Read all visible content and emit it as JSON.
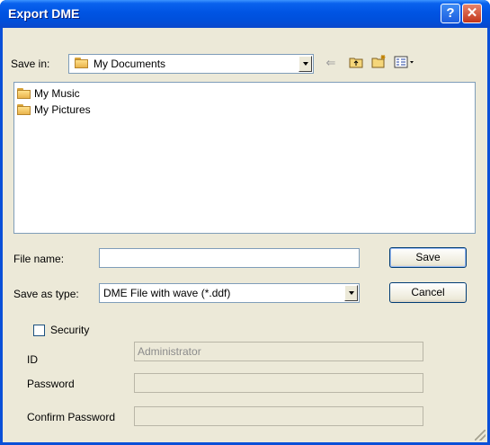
{
  "window": {
    "title": "Export DME",
    "help_label": "?",
    "close_label": "✕"
  },
  "save_in": {
    "label": "Save in:",
    "value": "My Documents"
  },
  "toolbar": {
    "back_icon": "back-arrow-icon",
    "up_icon": "up-folder-icon",
    "new_folder_icon": "new-folder-icon",
    "view_icon": "view-menu-icon"
  },
  "files": [
    {
      "label": "My Music",
      "icon": "music-folder-icon"
    },
    {
      "label": "My Pictures",
      "icon": "pictures-folder-icon"
    }
  ],
  "file_name": {
    "label": "File name:",
    "value": ""
  },
  "save_as_type": {
    "label": "Save as type:",
    "value": "DME File with wave (*.ddf)"
  },
  "buttons": {
    "save": "Save",
    "cancel": "Cancel"
  },
  "security": {
    "checkbox_label": "Security",
    "checked": false,
    "id_label": "ID",
    "id_value": "Administrator",
    "password_label": "Password",
    "password_value": "",
    "confirm_label": "Confirm Password",
    "confirm_value": ""
  },
  "colors": {
    "titlebar": "#0054e3",
    "dialog_bg": "#ece9d8",
    "close_button": "#c2351a"
  }
}
